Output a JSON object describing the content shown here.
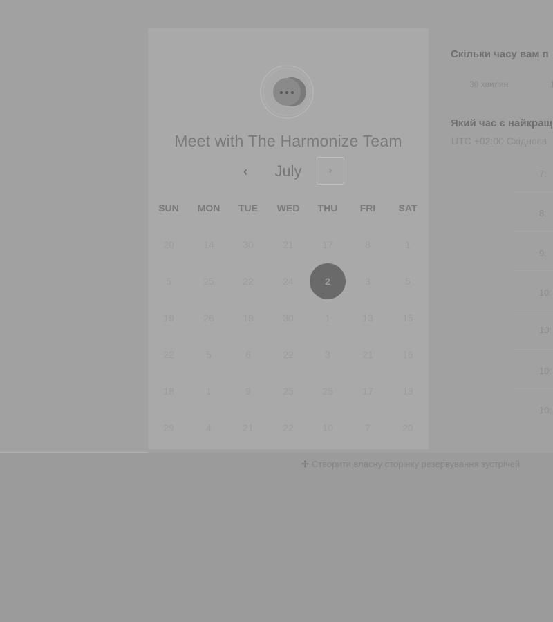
{
  "card": {
    "title": "Meet with The Harmonize Team",
    "logo_icon": "chat-bubble-icon",
    "month": "July",
    "prev_icon": "chevron-left-icon",
    "next_icon": "chevron-right-icon",
    "prev_glyph": "‹",
    "next_glyph": "›",
    "weekdays": [
      "SUN",
      "MON",
      "TUE",
      "WED",
      "THU",
      "FRI",
      "SAT"
    ],
    "weeks": [
      [
        "20",
        "14",
        "30",
        "21",
        "17",
        "8",
        "1"
      ],
      [
        "5",
        "25",
        "22",
        "24",
        "2",
        "3",
        "5"
      ],
      [
        "19",
        "26",
        "19",
        "30",
        "1",
        "13",
        "15"
      ],
      [
        "22",
        "5",
        "6",
        "22",
        "3",
        "21",
        "16"
      ],
      [
        "18",
        "1",
        "9",
        "25",
        "25",
        "17",
        "18"
      ],
      [
        "29",
        "4",
        "21",
        "22",
        "10",
        "7",
        "20"
      ]
    ],
    "selected_day": "2"
  },
  "panel": {
    "duration_question": "Скільки часу вам п",
    "duration_option_1": "30 хвилин",
    "duration_option_2": "1",
    "time_question": "Який час є найкращ",
    "timezone": "UTC +02:00 Східноєв",
    "slots": [
      "7:",
      "8:",
      "9:",
      "10:",
      "10:",
      "10:",
      "10:"
    ]
  },
  "footer": {
    "link_text": "Створити власну сторінку резервування зустрічей",
    "link_icon": "hubspot-sprocket-icon",
    "icon_glyph": "✢"
  },
  "colors": {
    "overlay": "#9b9b9b",
    "card": "#a9a9a9",
    "selected_day": "#6a6a6a"
  }
}
